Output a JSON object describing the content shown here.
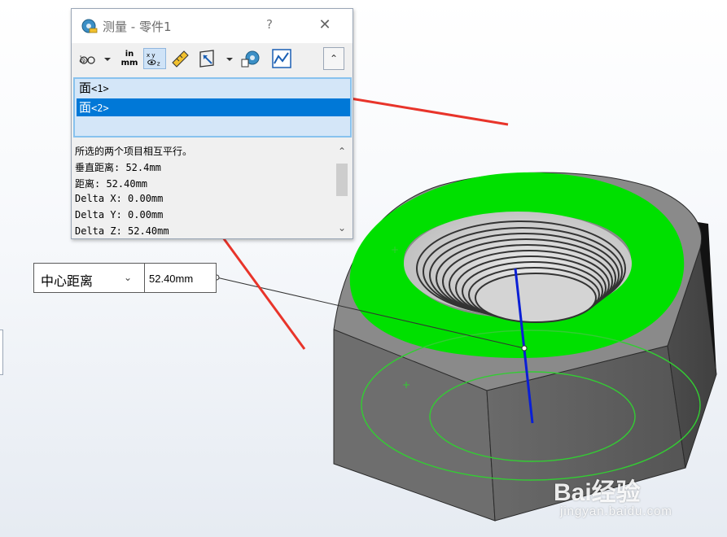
{
  "dialog": {
    "title": "测量 - 零件1",
    "help": "?",
    "close": "✕",
    "toolbar": {
      "icons": [
        "arc-circle-icon",
        "dropdown-icon",
        "units-icon",
        "xyz-icon",
        "measure-icon",
        "projection-icon",
        "dropdown-icon",
        "history-icon",
        "sensor-icon"
      ],
      "units_top": "in",
      "units_bottom": "mm",
      "collapse": "⌃"
    },
    "selections": [
      {
        "face": "面",
        "tag": "<1>"
      },
      {
        "face": "面",
        "tag": "<2>"
      }
    ],
    "results": [
      "所选的两个项目相互平行。",
      "垂直距离: 52.4mm",
      "距离: 52.40mm",
      "Delta X: 0.00mm",
      "Delta Y: 0.00mm",
      "Delta Z: 52.40mm"
    ]
  },
  "callout": {
    "mode": "中心距离",
    "value": "52.40mm"
  },
  "watermark": {
    "main": "Bai经验",
    "sub": "jingyan.baidu.com"
  },
  "colors": {
    "highlight_face": "#00e000",
    "sketch_green": "#33cc33",
    "axis_blue": "#0a1fd6",
    "arrow_red": "#e8342a",
    "selection_blue": "#0078d7"
  }
}
